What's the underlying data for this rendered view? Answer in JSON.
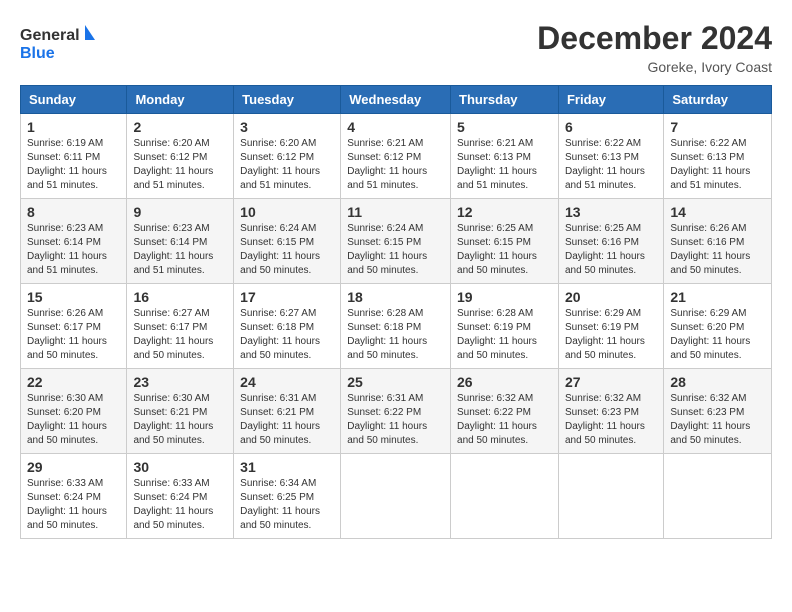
{
  "logo": {
    "text_general": "General",
    "text_blue": "Blue"
  },
  "title": {
    "month_year": "December 2024",
    "location": "Goreke, Ivory Coast"
  },
  "days_of_week": [
    "Sunday",
    "Monday",
    "Tuesday",
    "Wednesday",
    "Thursday",
    "Friday",
    "Saturday"
  ],
  "weeks": [
    [
      {
        "day": "1",
        "info": "Sunrise: 6:19 AM\nSunset: 6:11 PM\nDaylight: 11 hours\nand 51 minutes."
      },
      {
        "day": "2",
        "info": "Sunrise: 6:20 AM\nSunset: 6:12 PM\nDaylight: 11 hours\nand 51 minutes."
      },
      {
        "day": "3",
        "info": "Sunrise: 6:20 AM\nSunset: 6:12 PM\nDaylight: 11 hours\nand 51 minutes."
      },
      {
        "day": "4",
        "info": "Sunrise: 6:21 AM\nSunset: 6:12 PM\nDaylight: 11 hours\nand 51 minutes."
      },
      {
        "day": "5",
        "info": "Sunrise: 6:21 AM\nSunset: 6:13 PM\nDaylight: 11 hours\nand 51 minutes."
      },
      {
        "day": "6",
        "info": "Sunrise: 6:22 AM\nSunset: 6:13 PM\nDaylight: 11 hours\nand 51 minutes."
      },
      {
        "day": "7",
        "info": "Sunrise: 6:22 AM\nSunset: 6:13 PM\nDaylight: 11 hours\nand 51 minutes."
      }
    ],
    [
      {
        "day": "8",
        "info": "Sunrise: 6:23 AM\nSunset: 6:14 PM\nDaylight: 11 hours\nand 51 minutes."
      },
      {
        "day": "9",
        "info": "Sunrise: 6:23 AM\nSunset: 6:14 PM\nDaylight: 11 hours\nand 51 minutes."
      },
      {
        "day": "10",
        "info": "Sunrise: 6:24 AM\nSunset: 6:15 PM\nDaylight: 11 hours\nand 50 minutes."
      },
      {
        "day": "11",
        "info": "Sunrise: 6:24 AM\nSunset: 6:15 PM\nDaylight: 11 hours\nand 50 minutes."
      },
      {
        "day": "12",
        "info": "Sunrise: 6:25 AM\nSunset: 6:15 PM\nDaylight: 11 hours\nand 50 minutes."
      },
      {
        "day": "13",
        "info": "Sunrise: 6:25 AM\nSunset: 6:16 PM\nDaylight: 11 hours\nand 50 minutes."
      },
      {
        "day": "14",
        "info": "Sunrise: 6:26 AM\nSunset: 6:16 PM\nDaylight: 11 hours\nand 50 minutes."
      }
    ],
    [
      {
        "day": "15",
        "info": "Sunrise: 6:26 AM\nSunset: 6:17 PM\nDaylight: 11 hours\nand 50 minutes."
      },
      {
        "day": "16",
        "info": "Sunrise: 6:27 AM\nSunset: 6:17 PM\nDaylight: 11 hours\nand 50 minutes."
      },
      {
        "day": "17",
        "info": "Sunrise: 6:27 AM\nSunset: 6:18 PM\nDaylight: 11 hours\nand 50 minutes."
      },
      {
        "day": "18",
        "info": "Sunrise: 6:28 AM\nSunset: 6:18 PM\nDaylight: 11 hours\nand 50 minutes."
      },
      {
        "day": "19",
        "info": "Sunrise: 6:28 AM\nSunset: 6:19 PM\nDaylight: 11 hours\nand 50 minutes."
      },
      {
        "day": "20",
        "info": "Sunrise: 6:29 AM\nSunset: 6:19 PM\nDaylight: 11 hours\nand 50 minutes."
      },
      {
        "day": "21",
        "info": "Sunrise: 6:29 AM\nSunset: 6:20 PM\nDaylight: 11 hours\nand 50 minutes."
      }
    ],
    [
      {
        "day": "22",
        "info": "Sunrise: 6:30 AM\nSunset: 6:20 PM\nDaylight: 11 hours\nand 50 minutes."
      },
      {
        "day": "23",
        "info": "Sunrise: 6:30 AM\nSunset: 6:21 PM\nDaylight: 11 hours\nand 50 minutes."
      },
      {
        "day": "24",
        "info": "Sunrise: 6:31 AM\nSunset: 6:21 PM\nDaylight: 11 hours\nand 50 minutes."
      },
      {
        "day": "25",
        "info": "Sunrise: 6:31 AM\nSunset: 6:22 PM\nDaylight: 11 hours\nand 50 minutes."
      },
      {
        "day": "26",
        "info": "Sunrise: 6:32 AM\nSunset: 6:22 PM\nDaylight: 11 hours\nand 50 minutes."
      },
      {
        "day": "27",
        "info": "Sunrise: 6:32 AM\nSunset: 6:23 PM\nDaylight: 11 hours\nand 50 minutes."
      },
      {
        "day": "28",
        "info": "Sunrise: 6:32 AM\nSunset: 6:23 PM\nDaylight: 11 hours\nand 50 minutes."
      }
    ],
    [
      {
        "day": "29",
        "info": "Sunrise: 6:33 AM\nSunset: 6:24 PM\nDaylight: 11 hours\nand 50 minutes."
      },
      {
        "day": "30",
        "info": "Sunrise: 6:33 AM\nSunset: 6:24 PM\nDaylight: 11 hours\nand 50 minutes."
      },
      {
        "day": "31",
        "info": "Sunrise: 6:34 AM\nSunset: 6:25 PM\nDaylight: 11 hours\nand 50 minutes."
      },
      {
        "day": "",
        "info": ""
      },
      {
        "day": "",
        "info": ""
      },
      {
        "day": "",
        "info": ""
      },
      {
        "day": "",
        "info": ""
      }
    ]
  ]
}
